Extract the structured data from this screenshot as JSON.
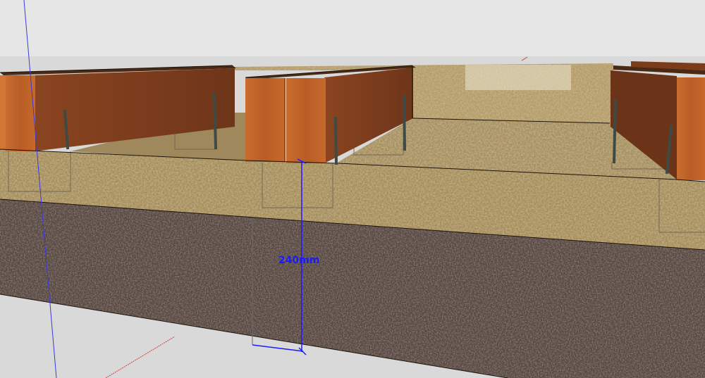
{
  "viewport": {
    "sky_color": "#e6e6e6",
    "ground_color": "#d9d9d9"
  },
  "dimension": {
    "label": "240mm",
    "color": "#1a1aff"
  },
  "materials": {
    "concrete_slab": "#54463f",
    "sand_fill": "#a48c5a",
    "formwork_wood": "#c0652b",
    "rebar": "#3f4a44"
  },
  "axes": {
    "blue_axis": "#3a3adb",
    "red_axis": "#d04040"
  }
}
